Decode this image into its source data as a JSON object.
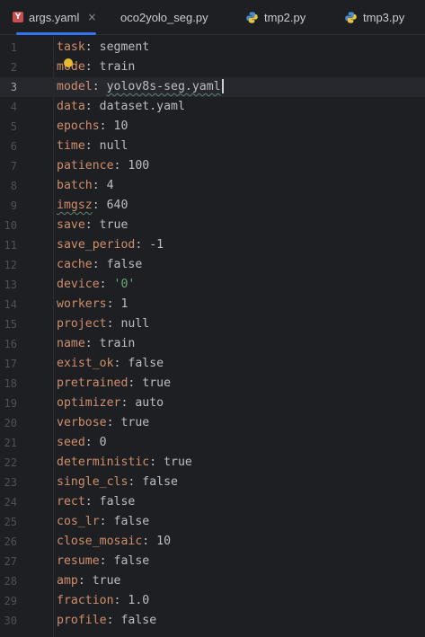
{
  "tabs": [
    {
      "label": "args.yaml",
      "icon": "yaml-file-icon",
      "active": true,
      "closable": true
    },
    {
      "label": "oco2yolo_seg.py",
      "icon": "",
      "active": false
    },
    {
      "label": "tmp2.py",
      "icon": "python-file-icon",
      "active": false
    },
    {
      "label": "tmp3.py",
      "icon": "python-file-icon",
      "active": false
    }
  ],
  "close_glyph": "×",
  "current_line": 3,
  "lines": [
    {
      "n": "1",
      "key": "task",
      "value": "segment"
    },
    {
      "n": "2",
      "key": "mode",
      "value": "train"
    },
    {
      "n": "3",
      "key": "model",
      "value": "yolov8s-seg.yaml"
    },
    {
      "n": "4",
      "key": "data",
      "value": "dataset.yaml"
    },
    {
      "n": "5",
      "key": "epochs",
      "value": "10"
    },
    {
      "n": "6",
      "key": "time",
      "value": "null"
    },
    {
      "n": "7",
      "key": "patience",
      "value": "100"
    },
    {
      "n": "8",
      "key": "batch",
      "value": "4"
    },
    {
      "n": "9",
      "key": "imgsz",
      "value": "640"
    },
    {
      "n": "10",
      "key": "save",
      "value": "true"
    },
    {
      "n": "11",
      "key": "save_period",
      "value": "-1"
    },
    {
      "n": "12",
      "key": "cache",
      "value": "false"
    },
    {
      "n": "13",
      "key": "device",
      "value": "'0'"
    },
    {
      "n": "14",
      "key": "workers",
      "value": "1"
    },
    {
      "n": "15",
      "key": "project",
      "value": "null"
    },
    {
      "n": "16",
      "key": "name",
      "value": "train"
    },
    {
      "n": "17",
      "key": "exist_ok",
      "value": "false"
    },
    {
      "n": "18",
      "key": "pretrained",
      "value": "true"
    },
    {
      "n": "19",
      "key": "optimizer",
      "value": "auto"
    },
    {
      "n": "20",
      "key": "verbose",
      "value": "true"
    },
    {
      "n": "21",
      "key": "seed",
      "value": "0"
    },
    {
      "n": "22",
      "key": "deterministic",
      "value": "true"
    },
    {
      "n": "23",
      "key": "single_cls",
      "value": "false"
    },
    {
      "n": "24",
      "key": "rect",
      "value": "false"
    },
    {
      "n": "25",
      "key": "cos_lr",
      "value": "false"
    },
    {
      "n": "26",
      "key": "close_mosaic",
      "value": "10"
    },
    {
      "n": "27",
      "key": "resume",
      "value": "false"
    },
    {
      "n": "28",
      "key": "amp",
      "value": "true"
    },
    {
      "n": "29",
      "key": "fraction",
      "value": "1.0"
    },
    {
      "n": "30",
      "key": "profile",
      "value": "false"
    }
  ],
  "colors": {
    "background": "#1e1f22",
    "key": "#cf8e6d",
    "string": "#6aab73",
    "text": "#bcbec4",
    "accent": "#3574f0",
    "line_number": "#4e5157"
  }
}
